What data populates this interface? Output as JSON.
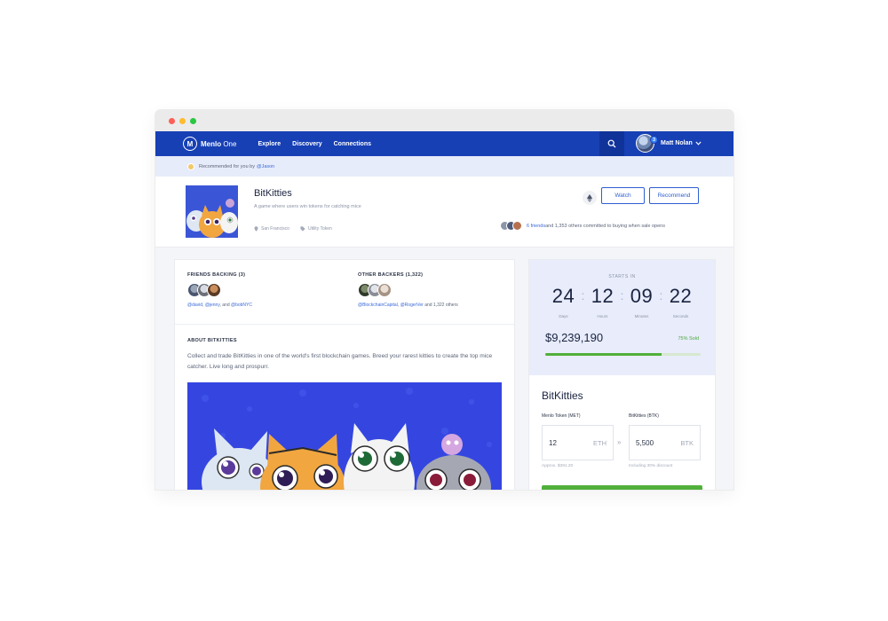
{
  "window": {
    "dots": [
      "#ff5f57",
      "#febc2e",
      "#28c840"
    ]
  },
  "nav": {
    "brand_mark": "M",
    "brand_bold": "Menlo",
    "brand_light": " One",
    "links": [
      "Explore",
      "Discovery",
      "Connections"
    ],
    "search_icon": "search-icon",
    "user_name": "Matt Nolan",
    "notification_count": "3"
  },
  "recommendation": {
    "text": "Recommended for you by ",
    "user": "@Jason"
  },
  "project": {
    "title": "BitKitties",
    "subtitle": "A game where users win tokens for catching mice",
    "location": "San Francisco",
    "category": "Utility Token",
    "watch_label": "Watch",
    "recommend_label": "Recommend",
    "friends_link": "6 friends",
    "friends_rest": " and 1,353 others committed to buying when sale opens"
  },
  "backers": {
    "friends_heading": "FRIENDS BACKING (3)",
    "friends_names_a": "@david",
    "friends_names_sep1": ", ",
    "friends_names_b": "@jenny",
    "friends_names_sep2": ", and ",
    "friends_names_c": "@bobNYC",
    "others_heading": "OTHER BACKERS (1,322)",
    "others_a": "@BlockchainCapital",
    "others_sep": ", ",
    "others_b": "@RogerVer",
    "others_rest": " and 1,322 others"
  },
  "about": {
    "heading": "ABOUT BITKITTIES",
    "text": "Collect and trade BitKitties in one of the world's first blockchain games. Breed your rarest kitties to create the top mice catcher. Live long and prospurr."
  },
  "countdown": {
    "label": "STARTS IN",
    "days": "24",
    "hours": "12",
    "minutes": "09",
    "seconds": "22",
    "days_label": "Days",
    "hours_label": "Hours",
    "minutes_label": "Minutes",
    "seconds_label": "Seconds",
    "raised": "$9,239,190",
    "sold_label": "75% Sold",
    "sold_fraction": 0.75
  },
  "purchase": {
    "title": "BitKitties",
    "from_label": "Menlo Token (MET)",
    "to_label": "BitKitties (BTK)",
    "from_value": "12",
    "from_unit": "ETH",
    "to_value": "5,500",
    "to_unit": "BTK",
    "from_hint": "Approx. $391.20",
    "to_hint": "Including 30% discount"
  },
  "colors": {
    "nav": "#1740b5",
    "accent": "#2f5fd0",
    "success": "#51b03a"
  }
}
